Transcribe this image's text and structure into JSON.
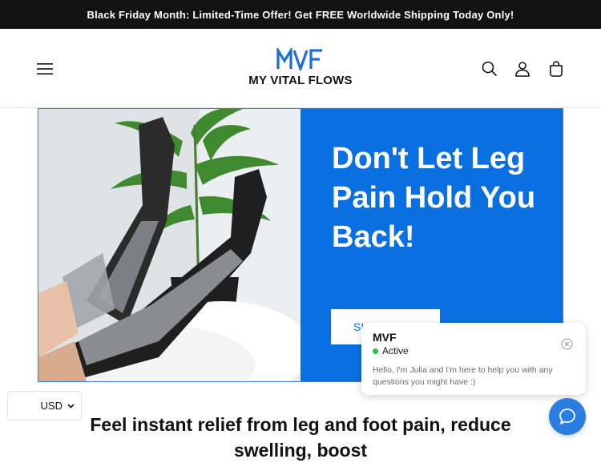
{
  "announcement": {
    "text": "Black Friday Month: Limited-Time Offer! Get FREE Worldwide Shipping Today Only!"
  },
  "header": {
    "brand_name": "MY VITAL FLOWS",
    "logo_mark": "MVF",
    "icons": [
      "menu-icon",
      "search-icon",
      "account-icon",
      "cart-icon"
    ]
  },
  "hero": {
    "title": "Don't Let Leg Pain Hold You Back!",
    "button_label": "SH",
    "panel_color": "#0a6fe0"
  },
  "currency": {
    "selected": "USD"
  },
  "tagline": {
    "text": "Feel instant relief from leg and foot pain, reduce swelling, boost"
  },
  "chat": {
    "agent": "MVF",
    "status": "Active",
    "message": "Hello, I'm Julia and I'm here to help you with any questions you might have :)"
  },
  "colors": {
    "accent": "#0a6fe0",
    "status_active": "#27c04a",
    "chat_button": "#2a7de1"
  }
}
